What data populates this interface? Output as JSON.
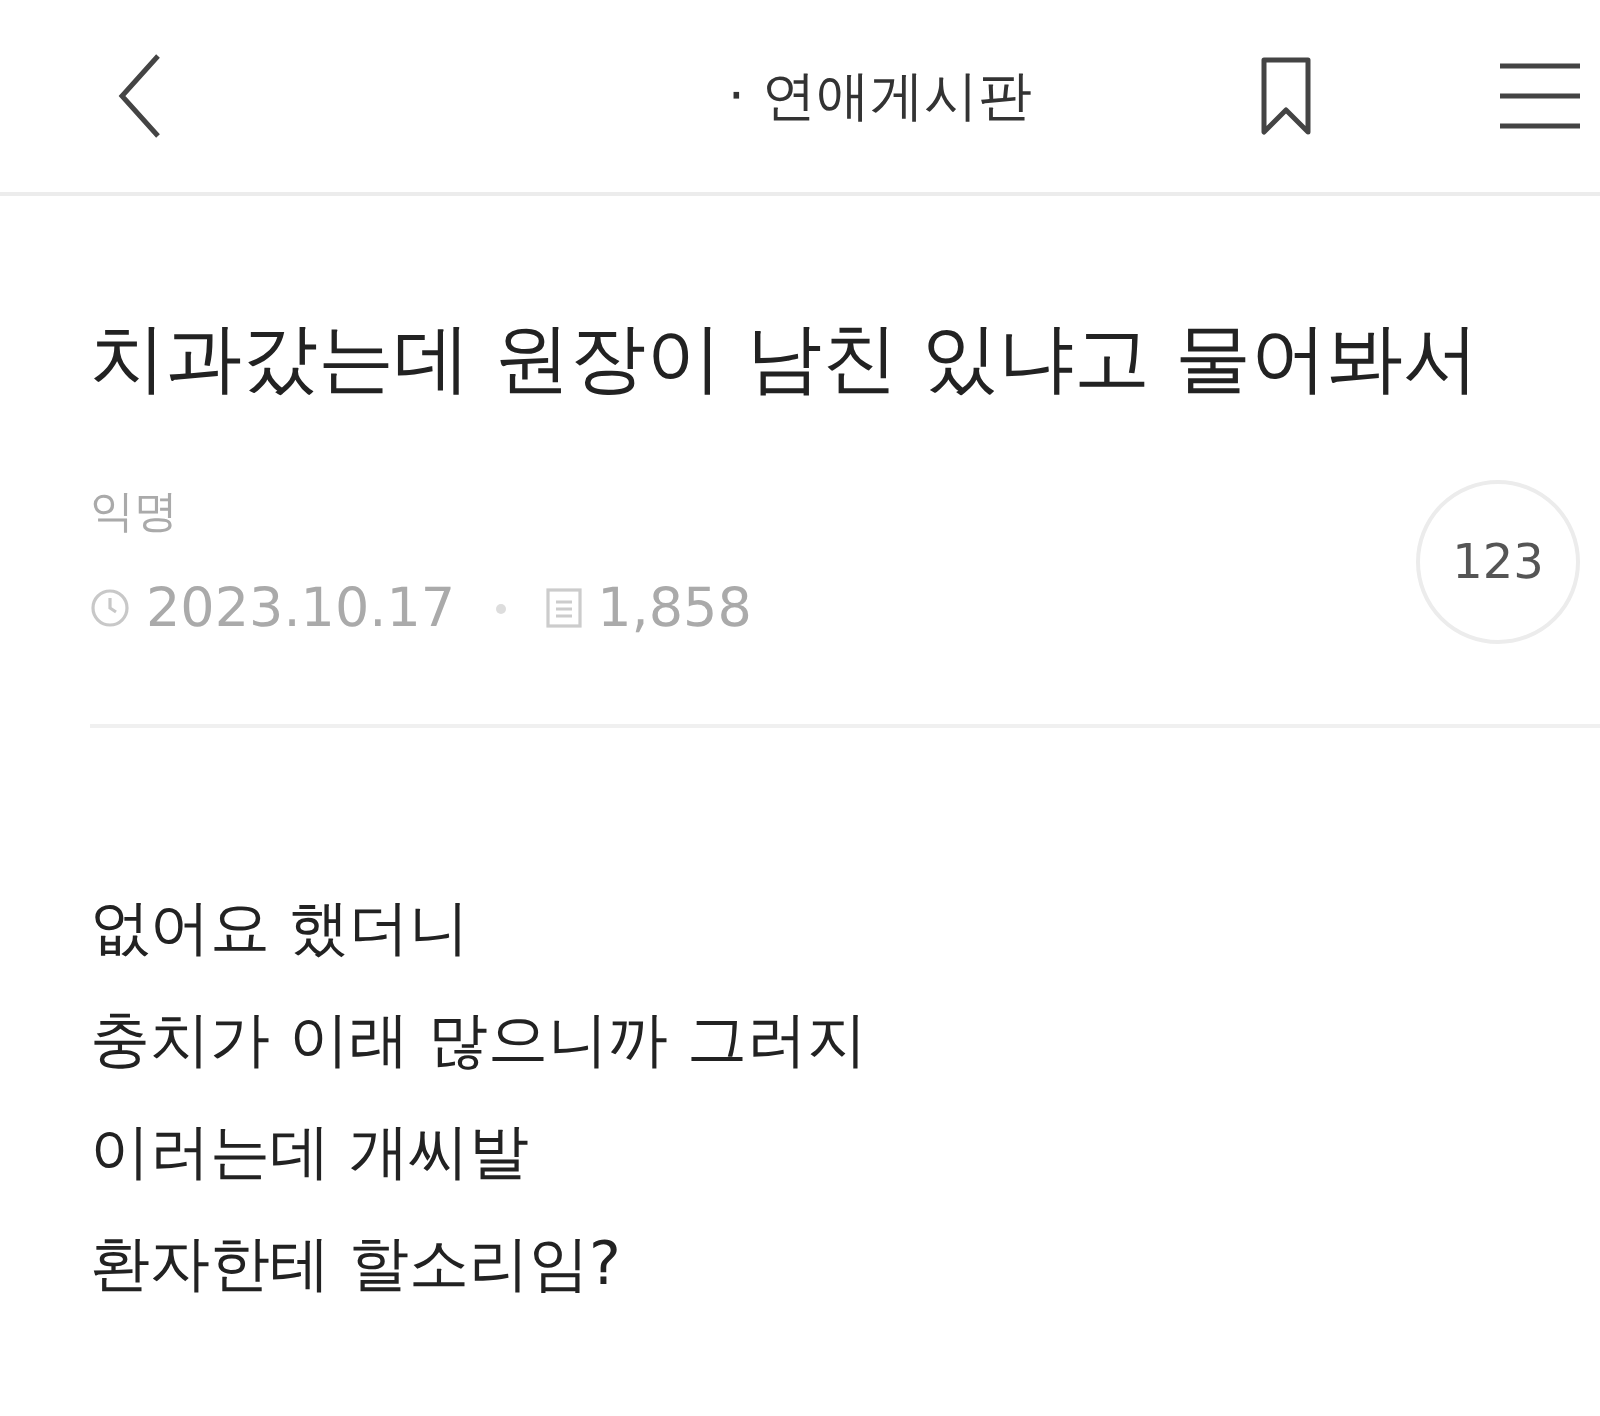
{
  "header": {
    "board_title": "· 연애게시판"
  },
  "post": {
    "title": "치과갔는데 원장이 남친 있냐고 물어봐서",
    "author": "익명",
    "date": "2023.10.17",
    "views": "1,858",
    "comment_count": "123",
    "body": [
      "없어요 했더니",
      "충치가 이래 많으니까 그러지",
      "이러는데 개씨발",
      "환자한테 할소리임?"
    ]
  }
}
